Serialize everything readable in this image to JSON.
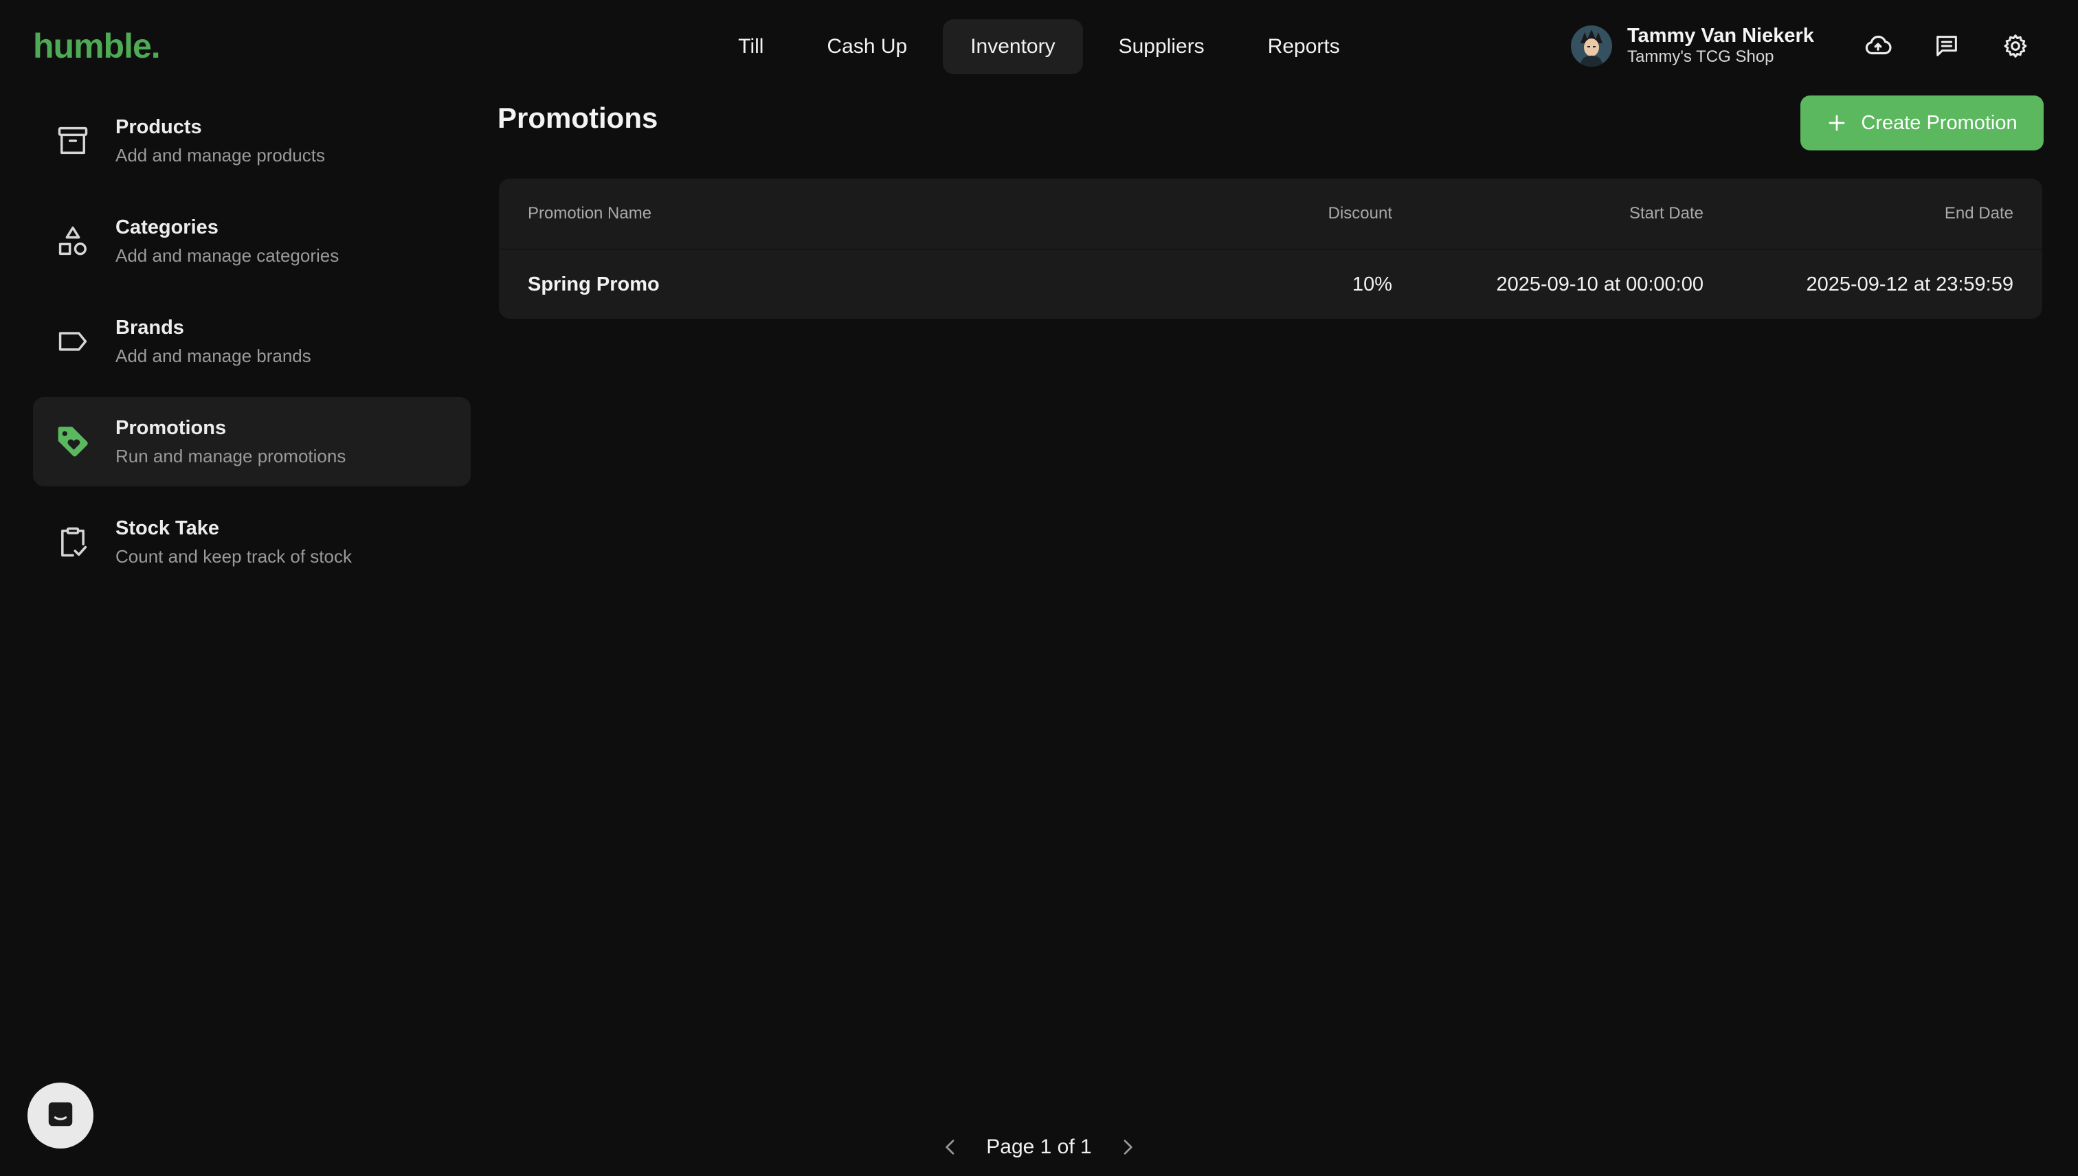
{
  "app": {
    "logo": "humble."
  },
  "nav": {
    "tabs": [
      {
        "label": "Till"
      },
      {
        "label": "Cash Up"
      },
      {
        "label": "Inventory",
        "active": true
      },
      {
        "label": "Suppliers"
      },
      {
        "label": "Reports"
      }
    ]
  },
  "user": {
    "name": "Tammy Van Niekerk",
    "shop": "Tammy's TCG Shop"
  },
  "sidebar": {
    "items": [
      {
        "title": "Products",
        "subtitle": "Add and manage products",
        "icon": "archive-box-icon"
      },
      {
        "title": "Categories",
        "subtitle": "Add and manage categories",
        "icon": "shapes-icon"
      },
      {
        "title": "Brands",
        "subtitle": "Add and manage brands",
        "icon": "label-tag-icon"
      },
      {
        "title": "Promotions",
        "subtitle": "Run and manage promotions",
        "icon": "tag-heart-icon",
        "active": true
      },
      {
        "title": "Stock Take",
        "subtitle": "Count and keep track of stock",
        "icon": "clipboard-check-icon"
      }
    ]
  },
  "main": {
    "title": "Promotions",
    "create_button": "Create Promotion",
    "table": {
      "headers": [
        "Promotion Name",
        "Discount",
        "Start Date",
        "End Date"
      ],
      "rows": [
        {
          "name": "Spring Promo",
          "discount": "10%",
          "start": "2025-09-10 at 00:00:00",
          "end": "2025-09-12 at 23:59:59"
        }
      ]
    },
    "pagination": {
      "text": "Page 1 of 1"
    }
  },
  "colors": {
    "background": "#0e0e0e",
    "accent": "#5cb85f",
    "logo": "#4faa55",
    "panel": "#1b1b1b"
  }
}
